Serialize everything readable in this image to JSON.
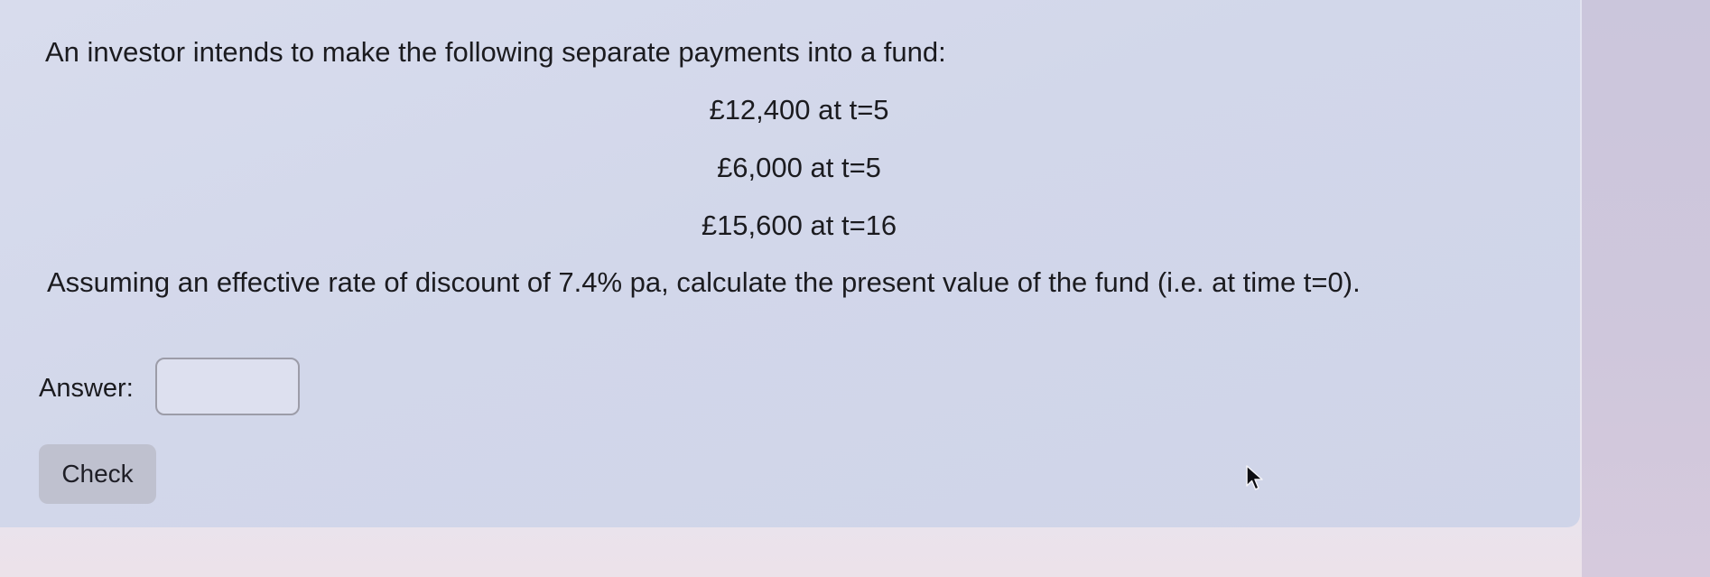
{
  "question": {
    "intro": "An investor intends to make the following separate payments into a fund:",
    "payments": [
      "£12,400 at t=5",
      "£6,000 at t=5",
      "£15,600 at t=16"
    ],
    "task": "Assuming an effective rate of discount of 7.4% pa, calculate the present value of the fund (i.e. at time t=0)."
  },
  "answer": {
    "label": "Answer:",
    "value": ""
  },
  "check_button": {
    "label": "Check"
  },
  "icons": {
    "cursor": "mouse-pointer-icon"
  }
}
